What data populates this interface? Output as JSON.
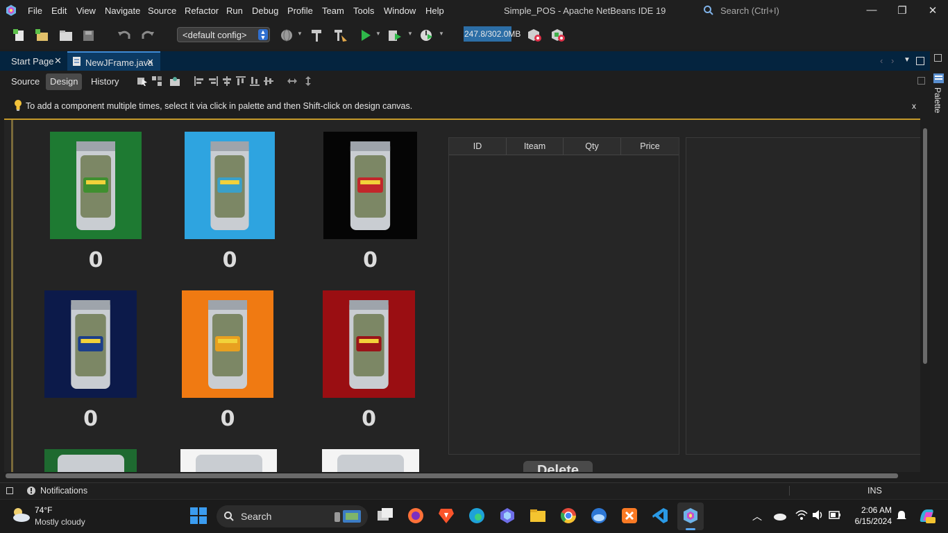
{
  "menubar": {
    "items": [
      "File",
      "Edit",
      "View",
      "Navigate",
      "Source",
      "Refactor",
      "Run",
      "Debug",
      "Profile",
      "Team",
      "Tools",
      "Window",
      "Help"
    ],
    "title": "Simple_POS - Apache NetBeans IDE 19",
    "search_placeholder": "Search (Ctrl+I)"
  },
  "toolbar": {
    "config": "<default config>",
    "memory": "247.8/302.0MB",
    "memory_fraction": 0.82
  },
  "editor_tabs": [
    {
      "label": "Start Page",
      "active": false
    },
    {
      "label": "NewJFrame.java",
      "active": true
    }
  ],
  "view_buttons": {
    "source": "Source",
    "design": "Design",
    "history": "History"
  },
  "hint": {
    "text": "To add a component multiple times, select it via click in palette and then Shift-click on design canvas.",
    "close": "x"
  },
  "products": [
    {
      "qty": "0",
      "bg": "#1e7a32",
      "label_color": "#3f8f2f"
    },
    {
      "qty": "0",
      "bg": "#2ea4e0",
      "label_color": "#3aa0c8"
    },
    {
      "qty": "0",
      "bg": "#050505",
      "label_color": "#c2262a"
    },
    {
      "qty": "0",
      "bg": "#0c1a4a",
      "label_color": "#1c3f8a"
    },
    {
      "qty": "0",
      "bg": "#f07a12",
      "label_color": "#e8a020"
    },
    {
      "qty": "0",
      "bg": "#9a0e12",
      "label_color": "#9a1418"
    }
  ],
  "order_table": {
    "columns": [
      "ID",
      "Iteam",
      "Qty",
      "Price"
    ]
  },
  "delete_button": "Delete",
  "palette_label": "Palette",
  "status": {
    "notifications": "Notifications",
    "mode": "INS"
  },
  "taskbar": {
    "weather_temp": "74°F",
    "weather_cond": "Mostly cloudy",
    "search": "Search",
    "time": "2:06 AM",
    "date": "6/15/2024"
  }
}
